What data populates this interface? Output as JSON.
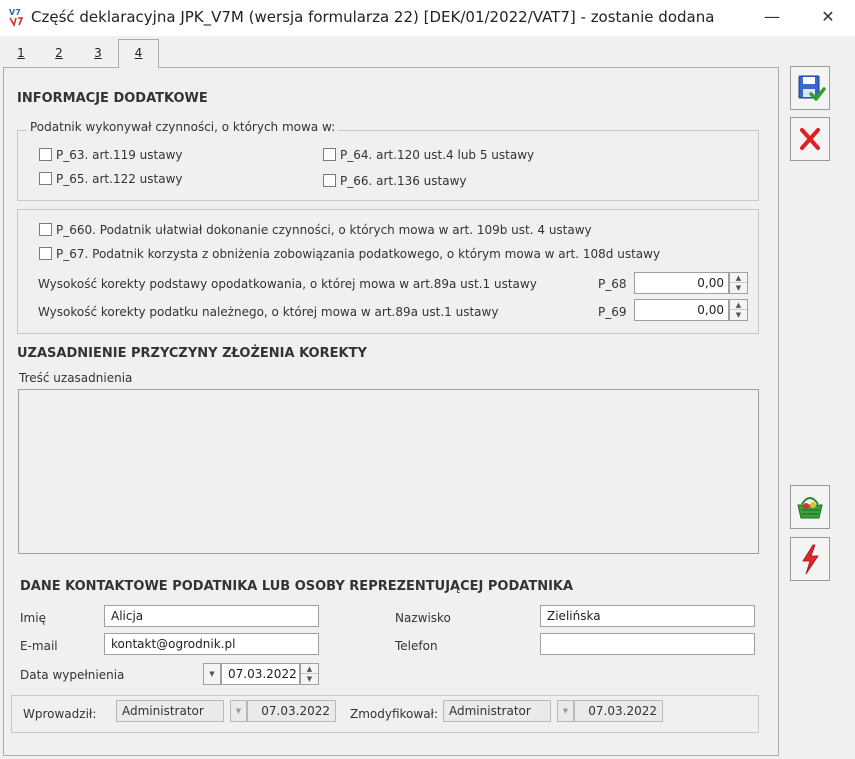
{
  "window": {
    "title": "Część deklaracyjna JPK_V7M (wersja formularza 22) [DEK/01/2022/VAT7] - zostanie dodana",
    "app_icon_label": "V7",
    "minimize_glyph": "—",
    "close_glyph": "✕"
  },
  "tabs": [
    "1",
    "2",
    "3",
    "4"
  ],
  "active_tab": "4",
  "info": {
    "heading": "INFORMACJE DODATKOWE",
    "group_legend": "Podatnik wykonywał czynności, o których mowa w:",
    "p63": "P_63. art.119 ustawy",
    "p64": "P_64. art.120 ust.4 lub 5 ustawy",
    "p65": "P_65. art.122 ustawy",
    "p66": "P_66. art.136 ustawy",
    "p660": "P_660. Podatnik ułatwiał dokonanie czynności, o których mowa w art. 109b ust. 4 ustawy",
    "p67": "P_67. Podatnik korzysta z obniżenia zobowiązania podatkowego, o którym mowa w art. 108d ustawy",
    "p68_label": "Wysokość korekty podstawy opodatkowania, o której mowa w art.89a ust.1 ustawy",
    "p68_code": "P_68",
    "p68_value": "0,00",
    "p69_label": "Wysokość korekty podatku należnego, o której mowa w art.89a ust.1 ustawy",
    "p69_code": "P_69",
    "p69_value": "0,00"
  },
  "justification": {
    "heading": "UZASADNIENIE PRZYCZYNY ZŁOŻENIA KOREKTY",
    "content_label": "Treść uzasadnienia",
    "content_value": ""
  },
  "contact": {
    "heading": "DANE KONTAKTOWE PODATNIKA LUB OSOBY REPREZENTUJĄCEJ PODATNIKA",
    "first_name_label": "Imię",
    "first_name": "Alicja",
    "last_name_label": "Nazwisko",
    "last_name": "Zielińska",
    "email_label": "E-mail",
    "email": "kontakt@ogrodnik.pl",
    "phone_label": "Telefon",
    "phone": "",
    "date_label": "Data wypełnienia",
    "date": "07.03.2022"
  },
  "footer": {
    "entered_label": "Wprowadził:",
    "entered_by": "Administrator",
    "entered_date": "07.03.2022",
    "modified_label": "Zmodyfikował:",
    "modified_by": "Administrator",
    "modified_date": "07.03.2022"
  },
  "side_buttons": [
    "save-icon",
    "cancel-icon",
    "basket-icon",
    "lightning-icon"
  ],
  "colors": {
    "cancel_red": "#e02020",
    "save_blue": "#2060c0",
    "save_green": "#30a030"
  }
}
